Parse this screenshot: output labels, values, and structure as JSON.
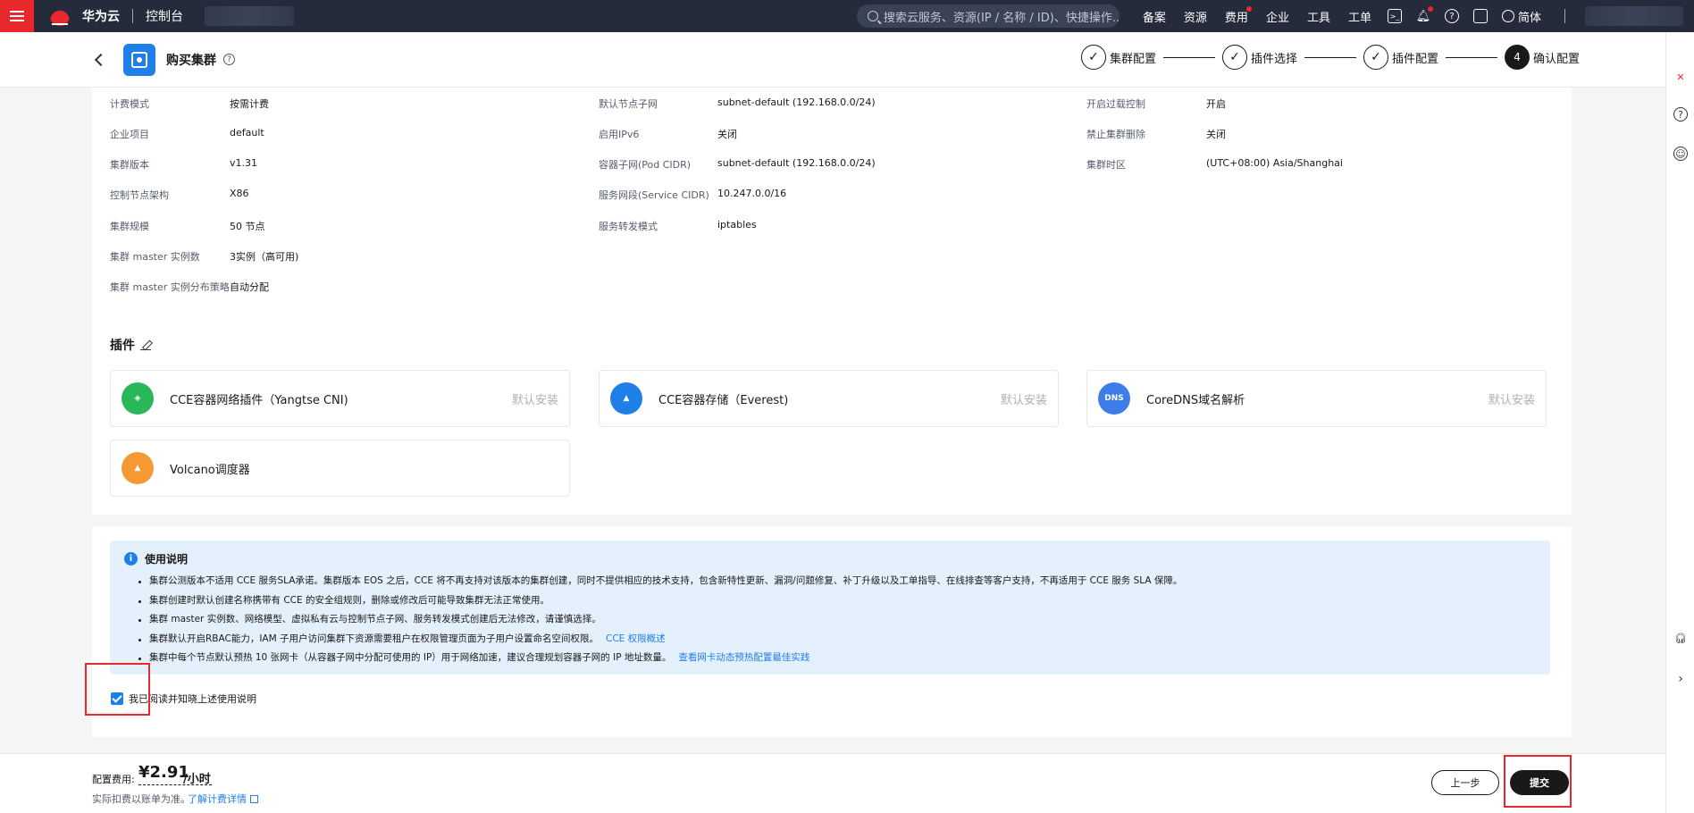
{
  "topnav": {
    "brand": "华为云",
    "console": "控制台",
    "search_placeholder": "搜索云服务、资源(IP / 名称 / ID)、快捷操作...",
    "items": [
      "备案",
      "资源",
      "费用",
      "企业",
      "工具",
      "工单"
    ],
    "lang": "简体"
  },
  "header": {
    "title": "购买集群",
    "steps": [
      {
        "label": "集群配置",
        "mark": "✓"
      },
      {
        "label": "插件选择",
        "mark": "✓"
      },
      {
        "label": "插件配置",
        "mark": "✓"
      },
      {
        "label": "确认配置",
        "mark": "4"
      }
    ]
  },
  "config": {
    "col1": [
      {
        "k": "计费模式",
        "v": "按需计费"
      },
      {
        "k": "企业项目",
        "v": "default"
      },
      {
        "k": "集群版本",
        "v": "v1.31"
      },
      {
        "k": "控制节点架构",
        "v": "X86"
      },
      {
        "k": "集群规模",
        "v": "50 节点"
      },
      {
        "k": "集群 master 实例数",
        "v": "3实例（高可用)"
      },
      {
        "k": "集群 master 实例分布策略",
        "v": "自动分配"
      }
    ],
    "col2": [
      {
        "k": "默认节点子网",
        "v": "subnet-default (192.168.0.0/24)"
      },
      {
        "k": "启用IPv6",
        "v": "关闭"
      },
      {
        "k": "容器子网(Pod CIDR)",
        "v": "subnet-default (192.168.0.0/24)"
      },
      {
        "k": "服务网段(Service CIDR)",
        "v": "10.247.0.0/16"
      },
      {
        "k": "服务转发模式",
        "v": "iptables"
      }
    ],
    "col3": [
      {
        "k": "开启过载控制",
        "v": "开启"
      },
      {
        "k": "禁止集群删除",
        "v": "关闭"
      },
      {
        "k": "集群时区",
        "v": "(UTC+08:00) Asia/Shanghai"
      }
    ]
  },
  "plugins": {
    "title": "插件",
    "items": [
      {
        "name": "CCE容器网络插件（Yangtse CNI)",
        "status": "默认安装",
        "color": "#2ab75a"
      },
      {
        "name": "CCE容器存储（Everest)",
        "status": "默认安装",
        "color": "#1f7fe8"
      },
      {
        "name": "CoreDNS域名解析",
        "status": "默认安装",
        "color": "#3d7de8"
      },
      {
        "name": "Volcano调度器",
        "status": "",
        "color": "#f59a32"
      }
    ],
    "dns_badge": "DNS"
  },
  "notice": {
    "title": "使用说明",
    "items": [
      {
        "text": "集群公测版本不适用 CCE 服务SLA承诺。集群版本 EOS 之后，CCE 将不再支持对该版本的集群创建，同时不提供相应的技术支持，包含新特性更新、漏洞/问题修复、补丁升级以及工单指导、在线排查等客户支持，不再适用于 CCE 服务 SLA 保障。",
        "link": ""
      },
      {
        "text": "集群创建时默认创建名称携带有 CCE 的安全组规则，删除或修改后可能导致集群无法正常使用。",
        "link": ""
      },
      {
        "text": "集群 master 实例数、网络模型、虚拟私有云与控制节点子网、服务转发模式创建后无法修改，请谨慎选择。",
        "link": ""
      },
      {
        "text": "集群默认开启RBAC能力，IAM 子用户访问集群下资源需要租户在权限管理页面为子用户设置命名空间权限。",
        "link": "CCE 权限概述"
      },
      {
        "text": "集群中每个节点默认预热 10 张网卡（从容器子网中分配可使用的 IP）用于网络加速，建议合理规划容器子网的 IP 地址数量。",
        "link": "查看网卡动态预热配置最佳实践"
      }
    ],
    "agree": "我已阅读并知晓上述使用说明"
  },
  "footer": {
    "label": "配置费用:",
    "price": "¥2.91",
    "unit": "/小时",
    "note": "实际扣费以账单为准。",
    "link": "了解计费详情",
    "prev": "上一步",
    "submit": "提交"
  },
  "colors": {
    "accent": "#1f7fe8",
    "nav": "#252b3a",
    "brand": "#e8282d"
  }
}
